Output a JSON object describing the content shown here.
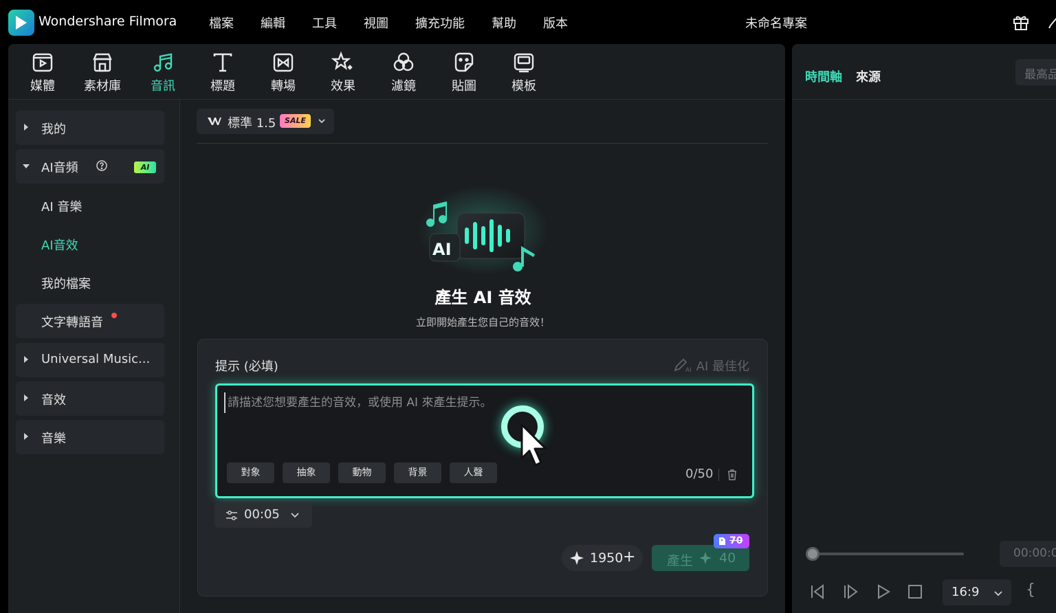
{
  "app": {
    "name": "Wondershare Filmora",
    "project_title": "未命名專案"
  },
  "menu": [
    "檔案",
    "編輯",
    "工具",
    "視圖",
    "擴充功能",
    "幫助",
    "版本"
  ],
  "toolbar": [
    {
      "label": "媒體",
      "icon": "media-icon"
    },
    {
      "label": "素材庫",
      "icon": "store-icon"
    },
    {
      "label": "音訊",
      "icon": "music-note-icon",
      "active": true
    },
    {
      "label": "標題",
      "icon": "title-text-icon"
    },
    {
      "label": "轉場",
      "icon": "transition-icon"
    },
    {
      "label": "效果",
      "icon": "effects-star-icon"
    },
    {
      "label": "濾鏡",
      "icon": "filter-icon"
    },
    {
      "label": "貼圖",
      "icon": "sticker-icon"
    },
    {
      "label": "模板",
      "icon": "template-icon"
    }
  ],
  "sidebar": {
    "mine": "我的",
    "ai_audio": "AI音頻",
    "ai_badge": "AI",
    "ai_music": "AI 音樂",
    "ai_sfx": "AI音效",
    "my_files": "我的檔案",
    "tts": "文字轉語音",
    "universal_music": "Universal Music...",
    "sound_effects": "音效",
    "music": "音樂"
  },
  "model_select": {
    "label": "標準 1.5",
    "badge": "SALE"
  },
  "hero": {
    "title": "產生 AI 音效",
    "subtitle": "立即開始產生您自己的音效！"
  },
  "prompt": {
    "label": "提示 (必填)",
    "optimize": "AI 最佳化",
    "placeholder": "請描述您想要產生的音效，或使用 AI 來產生提示。",
    "value": "",
    "chips": [
      "對象",
      "抽象",
      "動物",
      "背景",
      "人聲"
    ],
    "counter": "0/50"
  },
  "duration": "00:05",
  "credits": {
    "balance": "1950",
    "generate_label": "產生",
    "cost": "40",
    "original_cost": "70"
  },
  "right_panel": {
    "tab_timeline": "時間軸",
    "tab_source": "來源",
    "quality": "最高品",
    "timecode": "00:00:0",
    "aspect_ratio": "16:9"
  },
  "colors": {
    "accent": "#3fd9b6",
    "prompt_border": "#3ff0c8",
    "generate_bg": "#1f5a4c"
  }
}
